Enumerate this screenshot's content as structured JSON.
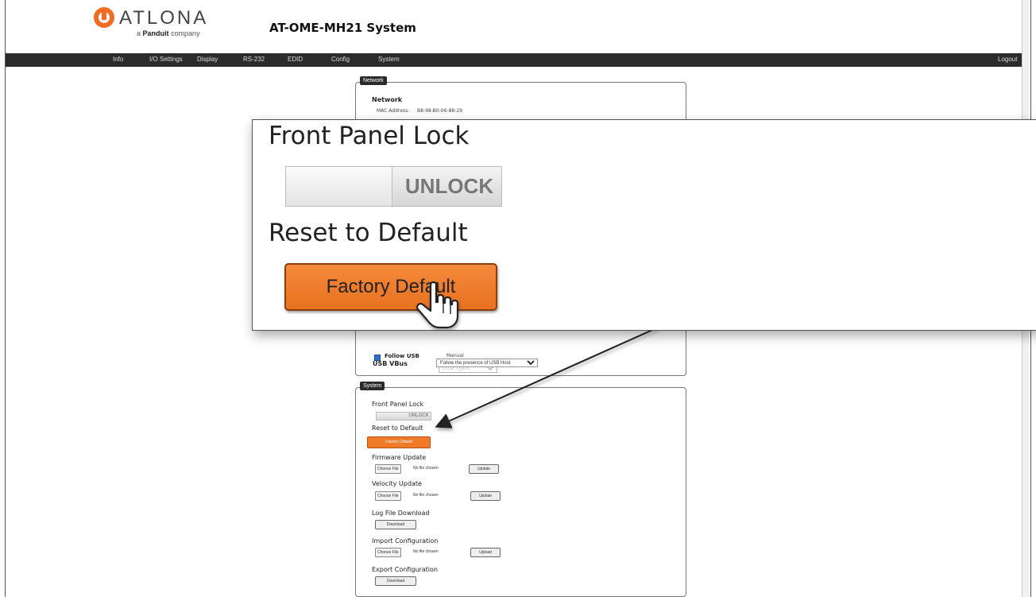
{
  "header": {
    "brand": "ATLONA",
    "brand_sub_prefix": "a",
    "brand_sub_company": "Panduit",
    "brand_sub_suffix": "company",
    "app_title": "AT-OME-MH21  System"
  },
  "nav": {
    "items": [
      "Info",
      "I/O Settings",
      "Display",
      "RS-232",
      "EDID",
      "Config",
      "System"
    ],
    "logout": "Logout"
  },
  "network_panel": {
    "tag": "Network",
    "heading": "Network",
    "mac_label": "MAC Address:",
    "mac_value": "B8-98-B0-06-88-29"
  },
  "usb_panel": {
    "follow_usb_label": "Follow USB",
    "manual_label": "Manual",
    "manual_select": "Local Type-C",
    "vbus_label": "USB VBus",
    "vbus_select": "Follow the presence of USB Host"
  },
  "system_panel": {
    "tag": "System",
    "front_panel_lock": "Front Panel Lock",
    "unlock": "UNLOCK",
    "reset_to_default": "Reset to Default",
    "factory_default": "Factory Default",
    "firmware_update": "Firmware Update",
    "velocity_update": "Velocity Update",
    "log_file_download": "Log File Download",
    "import_configuration": "Import Configuration",
    "export_configuration": "Export Configuration",
    "choose_file": "Choose File",
    "no_file": "No file chosen",
    "update": "Update",
    "download": "Download",
    "upload": "Upload"
  },
  "zoom": {
    "front_panel_lock": "Front Panel Lock",
    "unlock": "UNLOCK",
    "reset_to_default": "Reset to Default",
    "factory_default": "Factory Default"
  },
  "colors": {
    "accent_orange": "#f07a26",
    "navbar": "#2b2b2b"
  }
}
